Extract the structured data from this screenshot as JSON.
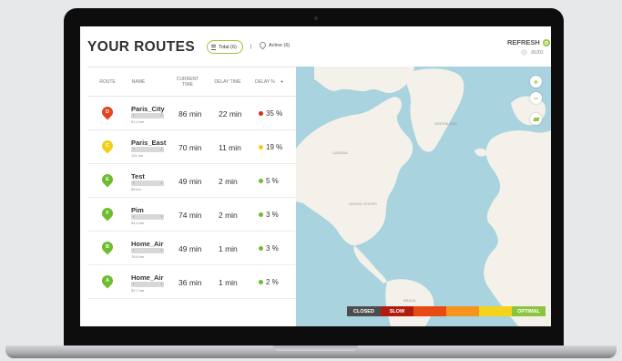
{
  "header": {
    "title": "YOUR ROUTES",
    "filter_total": "Total (6)",
    "filter_active": "Active (6)",
    "refresh": "REFRESH",
    "auto": "auto"
  },
  "table": {
    "headers": {
      "route": "ROUTE",
      "name": "NAME",
      "current_time": "CURRENT TIME",
      "delay_time": "DELAY TIME",
      "delay_pct": "DELAY %"
    },
    "rows": [
      {
        "letter": "D",
        "name": "Paris_City",
        "distance": "91.4 km",
        "current": "86 min",
        "delay": "22 min",
        "pct": "35 %",
        "pin_color": "#e0451f",
        "dot_color": "#dd2b1a"
      },
      {
        "letter": "C",
        "name": "Paris_East",
        "distance": "101 km",
        "current": "70 min",
        "delay": "11 min",
        "pct": "19 %",
        "pin_color": "#f0cf19",
        "dot_color": "#f0cf19"
      },
      {
        "letter": "E",
        "name": "Test",
        "distance": "58 km",
        "current": "49 min",
        "delay": "2 min",
        "pct": "5 %",
        "pin_color": "#6cbd2f",
        "dot_color": "#6cbd2f"
      },
      {
        "letter": "F",
        "name": "Pim",
        "distance": "94.4 km",
        "current": "74 min",
        "delay": "2 min",
        "pct": "3 %",
        "pin_color": "#6cbd2f",
        "dot_color": "#6cbd2f"
      },
      {
        "letter": "B",
        "name": "Home_Air",
        "distance": "76.6 km",
        "current": "49 min",
        "delay": "1 min",
        "pct": "3 %",
        "pin_color": "#6cbd2f",
        "dot_color": "#6cbd2f"
      },
      {
        "letter": "A",
        "name": "Home_Air",
        "distance": "52.7 km",
        "current": "36 min",
        "delay": "1 min",
        "pct": "2 %",
        "pin_color": "#6cbd2f",
        "dot_color": "#6cbd2f"
      }
    ]
  },
  "map": {
    "labels": [
      "GREENLAND",
      "UNITED STATES",
      "CANADA",
      "BRAZIL"
    ],
    "zoom_in": "+",
    "zoom_out": "−"
  },
  "legend": {
    "closed": "CLOSED",
    "slow": "SLOW",
    "optimal": "OPTIMAL",
    "colors": [
      "#4d4d4d",
      "#b21c10",
      "#e84a14",
      "#f7941d",
      "#f3d41a",
      "#8bc53f"
    ]
  },
  "colors": {
    "accent": "#9bc53d"
  }
}
